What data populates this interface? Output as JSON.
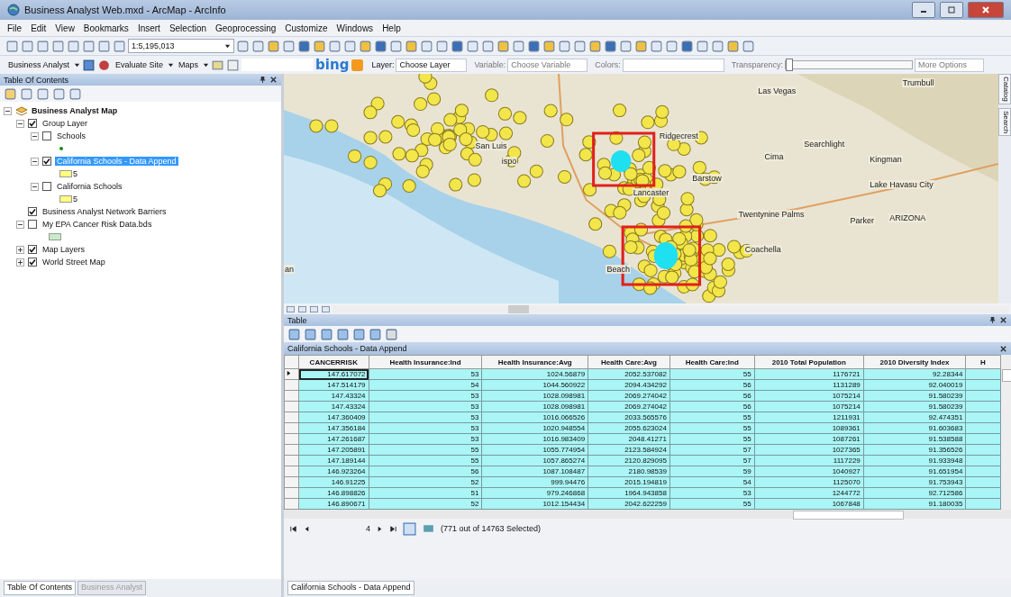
{
  "window": {
    "title": "Business Analyst Web.mxd - ArcMap - ArcInfo"
  },
  "menu": [
    "File",
    "Edit",
    "View",
    "Bookmarks",
    "Insert",
    "Selection",
    "Geoprocessing",
    "Customize",
    "Windows",
    "Help"
  ],
  "toolbar": {
    "scale": "1:5,195,013"
  },
  "ba_toolbar": {
    "business_analyst": "Business Analyst",
    "evaluate_site": "Evaluate Site",
    "maps": "Maps",
    "bing": "bing",
    "layer_label": "Layer:",
    "layer_value": "Choose Layer",
    "variable_label": "Variable:",
    "variable_value": "Choose Variable",
    "colors_label": "Colors:",
    "transparency": {
      "label": "Transparency:",
      "level": 0
    },
    "more_options": "More Options"
  },
  "toc": {
    "title": "Table Of Contents",
    "root": "Business Analyst Map",
    "items": [
      {
        "label": "Group Layer",
        "checked": true,
        "expanded": true,
        "selected": false,
        "children": [
          {
            "label": "Schools",
            "checked": false,
            "expanded": true,
            "selected": false,
            "legend": {
              "kind": "dot",
              "color": "#1a8a1a"
            }
          },
          {
            "label": "California Schools - Data Append",
            "checked": true,
            "expanded": true,
            "selected": true,
            "legend": {
              "kind": "swatch",
              "color": "#ffff80",
              "label": "5"
            }
          },
          {
            "label": "California Schools",
            "checked": false,
            "expanded": true,
            "selected": false,
            "legend": {
              "kind": "swatch",
              "color": "#ffff80",
              "label": "5"
            }
          }
        ]
      },
      {
        "label": "Business Analyst Network Barriers",
        "checked": true,
        "selected": false
      },
      {
        "label": "My EPA Cancer Risk Data.bds",
        "checked": false,
        "expanded": true,
        "selected": false,
        "legend": {
          "kind": "swatch",
          "color": "#c8ecc8"
        }
      },
      {
        "label": "Map Layers",
        "checked": true,
        "expanded": false,
        "selected": false
      },
      {
        "label": "World Street Map",
        "checked": true,
        "expanded": false,
        "selected": false
      }
    ]
  },
  "map": {
    "labels": [
      "Las Vegas",
      "Trumbull",
      "Ridgecrest",
      "Searchlight",
      "Cima",
      "Kingman",
      "Barstow",
      "Lake Havasu City",
      "Lancaster",
      "Twentynine Palms",
      "Parker",
      "ARIZONA",
      "Coachella",
      "San Luis",
      "ispo",
      "Beach",
      "an"
    ],
    "side_tabs": [
      "Catalog",
      "Search"
    ]
  },
  "table": {
    "title": "Table",
    "layer": "California Schools - Data Append",
    "columns": [
      "CANCERRISK",
      "Health Insurance:Ind",
      "Health Insurance:Avg",
      "Health Care:Avg",
      "Health Care:Ind",
      "2010 Total Population",
      "2010 Diversity Index",
      "H"
    ],
    "rows": [
      {
        "selected": true,
        "current": true,
        "cells": [
          "147.617072",
          "53",
          "1024.56879",
          "2052.537082",
          "55",
          "1176721",
          "92.28344",
          ""
        ]
      },
      {
        "selected": true,
        "current": false,
        "cells": [
          "147.514179",
          "54",
          "1044.560922",
          "2094.434292",
          "56",
          "1131289",
          "92.040019",
          ""
        ]
      },
      {
        "selected": true,
        "current": false,
        "cells": [
          "147.43324",
          "53",
          "1028.098981",
          "2069.274042",
          "56",
          "1075214",
          "91.580239",
          ""
        ]
      },
      {
        "selected": true,
        "current": false,
        "cells": [
          "147.43324",
          "53",
          "1028.098981",
          "2069.274042",
          "56",
          "1075214",
          "91.580239",
          ""
        ]
      },
      {
        "selected": true,
        "current": false,
        "cells": [
          "147.360409",
          "53",
          "1016.066526",
          "2033.565576",
          "55",
          "1211931",
          "92.474351",
          ""
        ]
      },
      {
        "selected": true,
        "current": false,
        "cells": [
          "147.356184",
          "53",
          "1020.948554",
          "2055.623024",
          "55",
          "1089361",
          "91.603683",
          ""
        ]
      },
      {
        "selected": true,
        "current": false,
        "cells": [
          "147.261687",
          "53",
          "1016.983409",
          "2048.41271",
          "55",
          "1087261",
          "91.538588",
          ""
        ]
      },
      {
        "selected": true,
        "current": false,
        "cells": [
          "147.205891",
          "55",
          "1055.774954",
          "2123.584924",
          "57",
          "1027365",
          "91.356526",
          ""
        ]
      },
      {
        "selected": true,
        "current": false,
        "cells": [
          "147.189144",
          "55",
          "1057.865274",
          "2120.829095",
          "57",
          "1117229",
          "91.933948",
          ""
        ]
      },
      {
        "selected": true,
        "current": false,
        "cells": [
          "146.923264",
          "56",
          "1087.108487",
          "2180.98539",
          "59",
          "1040927",
          "91.651954",
          ""
        ]
      },
      {
        "selected": true,
        "current": false,
        "cells": [
          "146.91225",
          "52",
          "999.94476",
          "2015.194819",
          "54",
          "1125070",
          "91.753943",
          ""
        ]
      },
      {
        "selected": true,
        "current": false,
        "cells": [
          "146.898826",
          "51",
          "979.246868",
          "1964.943858",
          "53",
          "1244772",
          "92.712586",
          ""
        ]
      },
      {
        "selected": true,
        "current": false,
        "cells": [
          "146.890671",
          "52",
          "1012.154434",
          "2042.622259",
          "55",
          "1067848",
          "91.180035",
          ""
        ]
      }
    ],
    "record": "4",
    "status": "(771 out of 14763 Selected)"
  },
  "bottom_tabs": [
    {
      "label": "Table Of Contents",
      "selected": true
    },
    {
      "label": "Business Analyst",
      "selected": false
    }
  ],
  "table_tab": "California Schools - Data Append"
}
